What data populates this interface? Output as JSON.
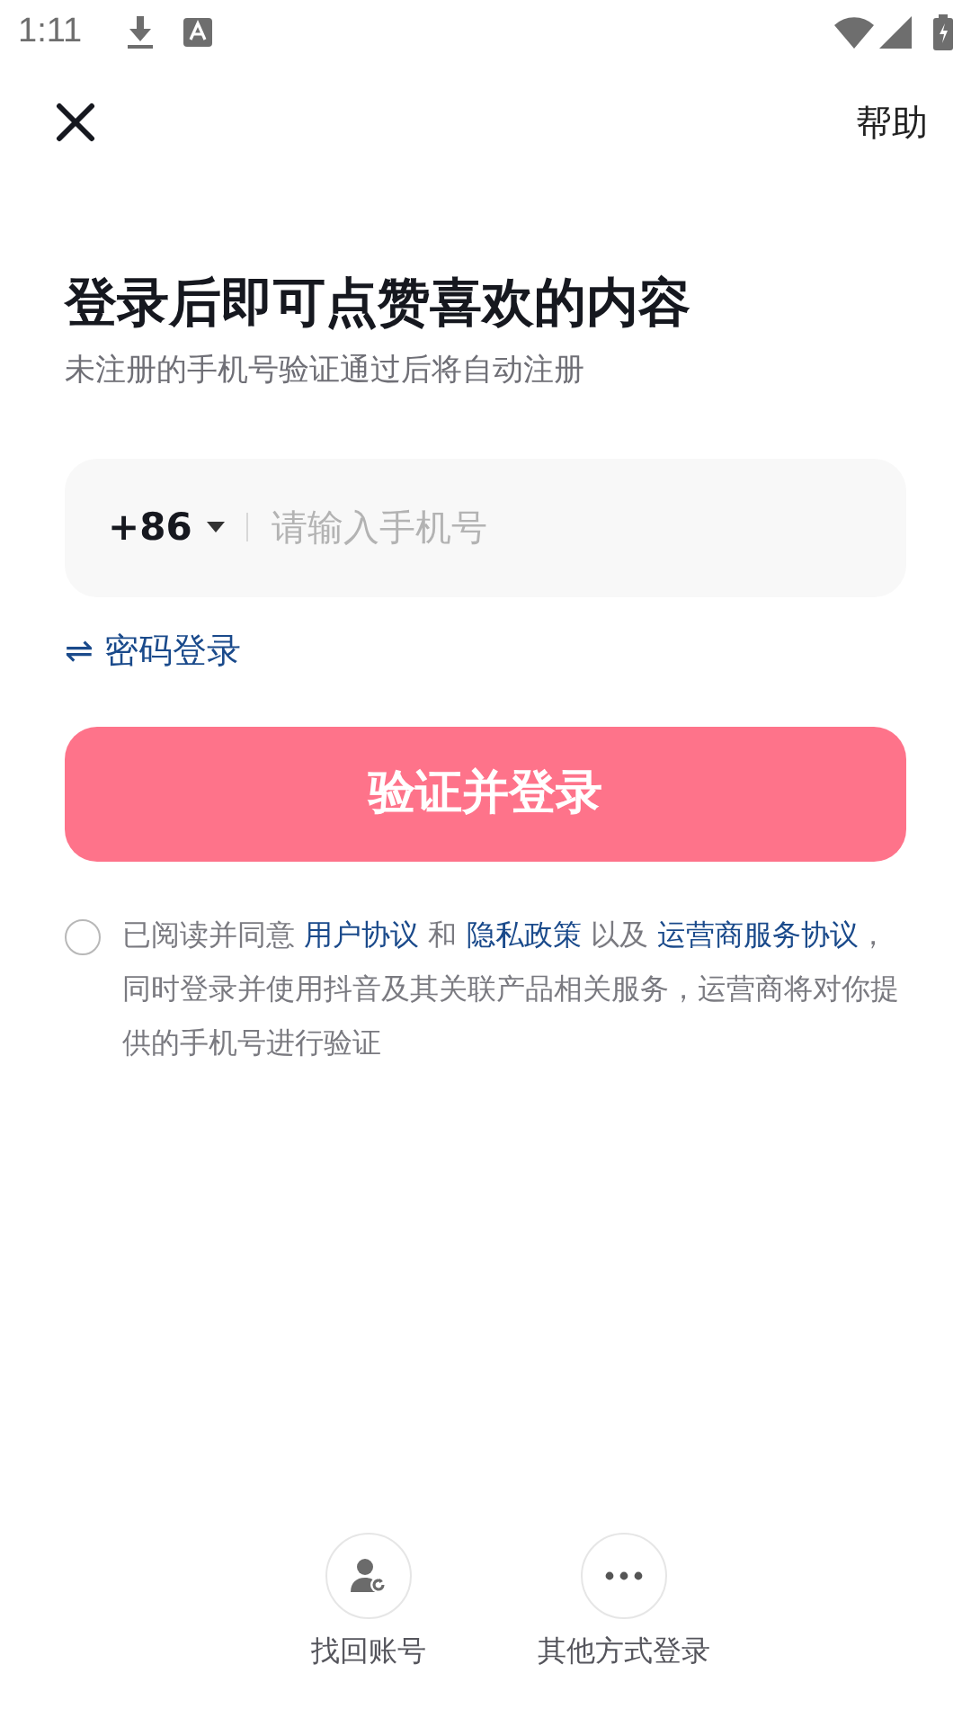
{
  "status_bar": {
    "time": "1:11"
  },
  "header": {
    "help": "帮助"
  },
  "title": "登录后即可点赞喜欢的内容",
  "subtitle": "未注册的手机号验证通过后将自动注册",
  "phone_field": {
    "country_code": "+86",
    "placeholder": "请输入手机号"
  },
  "password_login": {
    "icon": "⇌",
    "label": "密码登录"
  },
  "login_button": "验证并登录",
  "agreement": {
    "checked": false,
    "segments": [
      {
        "kind": "plain",
        "text": "已阅读并同意 "
      },
      {
        "kind": "link",
        "text": "用户协议"
      },
      {
        "kind": "plain",
        "text": " 和 "
      },
      {
        "kind": "link",
        "text": "隐私政策"
      },
      {
        "kind": "plain",
        "text": " 以及 "
      },
      {
        "kind": "link",
        "text": "运营商服务协议"
      },
      {
        "kind": "plain",
        "text": "，同时登录并使用抖音及其关联产品相关服务，运营商将对你提供的手机号进行验证"
      }
    ]
  },
  "bottom_actions": [
    {
      "kind": "recover",
      "label": "找回账号"
    },
    {
      "kind": "more",
      "label": "其他方式登录"
    }
  ]
}
